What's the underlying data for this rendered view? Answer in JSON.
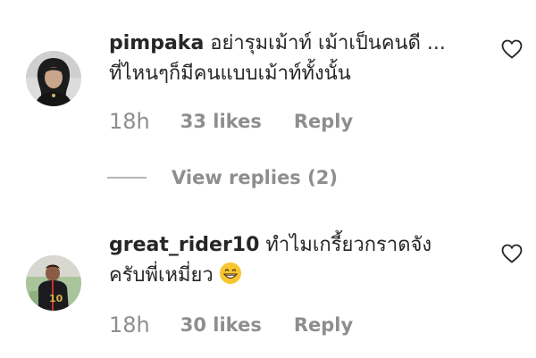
{
  "comments": [
    {
      "username": "pimpaka",
      "text_line1": "อย่ารุมเม้าท์ เม้าเป็นคนดี ...",
      "text_line2": "ที่ไหนๆก็มีคนแบบเม้าท์ทั้งนั้น",
      "time": "18h",
      "likes": "33 likes",
      "reply": "Reply",
      "avatar_icon": "avatar-woman-dark-hair",
      "like_icon": "heart-outline-icon"
    },
    {
      "username": "great_rider10",
      "text_line1": "ทำไมเกรี้ยวกราดจัง",
      "text_line2": "ครับพี่เหมี่ยว",
      "emoji": "😁",
      "time": "18h",
      "likes": "30 likes",
      "reply": "Reply",
      "avatar_icon": "avatar-soccer-player",
      "like_icon": "heart-outline-icon"
    }
  ],
  "view_replies": "View replies (2)",
  "colors": {
    "text": "#262626",
    "secondary": "#8e8e8e",
    "divider": "#b5b5b5"
  }
}
